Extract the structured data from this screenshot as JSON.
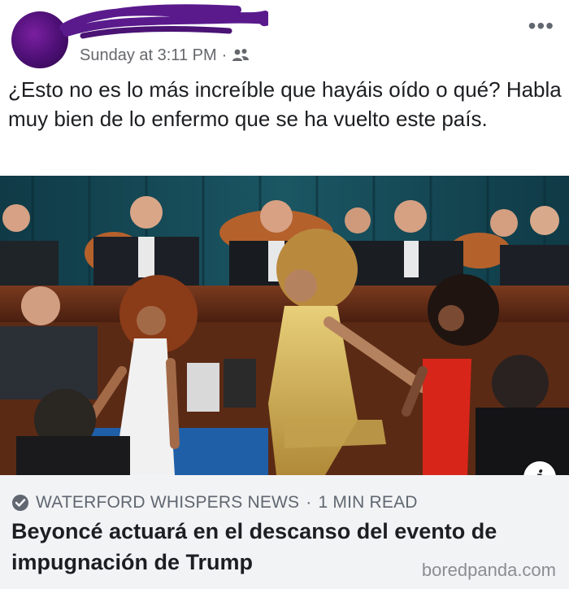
{
  "post": {
    "timestamp": "Sunday at 3:11 PM",
    "separator": "·",
    "audience_icon": "friends-icon",
    "more_icon": "ellipsis-icon",
    "more_label": "•••",
    "text": "¿Esto no es lo más increíble que hayáis oído o qué? Habla muy bien de lo enfermo que se ha vuelto este país."
  },
  "link_preview": {
    "image_alt": "performers dancing in front of a hearing panel",
    "info_label": "i",
    "source": "WATERFORD WHISPERS NEWS",
    "separator": "·",
    "read_time": "1 MIN READ",
    "headline": "Beyoncé actuará en el descanso del evento de impugnación de Trump"
  },
  "watermark": "boredpanda.com",
  "colors": {
    "scribble": "#5a1a8c",
    "link_bg": "#f2f3f5",
    "secondary_text": "#606770"
  }
}
